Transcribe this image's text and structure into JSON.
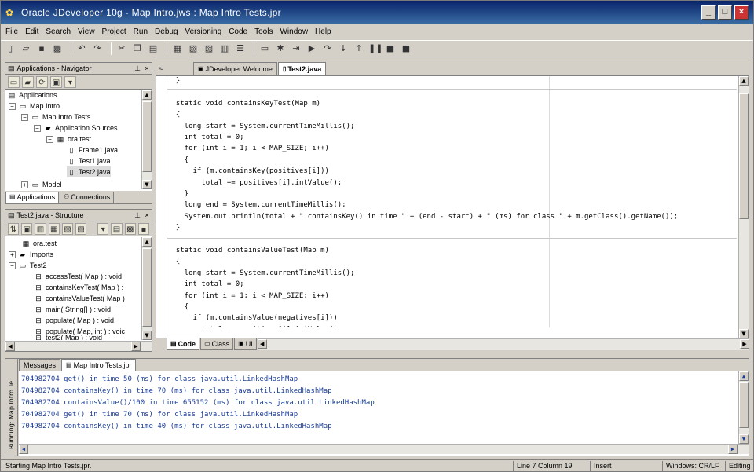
{
  "window": {
    "title": "Oracle JDeveloper 10g - Map Intro.jws : Map Intro Tests.jpr"
  },
  "menu": [
    "File",
    "Edit",
    "Search",
    "View",
    "Project",
    "Run",
    "Debug",
    "Versioning",
    "Code",
    "Tools",
    "Window",
    "Help"
  ],
  "navigator": {
    "title": "Applications - Navigator",
    "tree": [
      {
        "label": "Applications",
        "level": 0
      },
      {
        "label": "Map Intro",
        "level": 1
      },
      {
        "label": "Map Intro Tests",
        "level": 2
      },
      {
        "label": "Application Sources",
        "level": 3
      },
      {
        "label": "ora.test",
        "level": 4
      },
      {
        "label": "Frame1.java",
        "level": 5
      },
      {
        "label": "Test1.java",
        "level": 5
      },
      {
        "label": "Test2.java",
        "level": 5
      },
      {
        "label": "Model",
        "level": 2
      }
    ],
    "tabs": [
      "Applications",
      "Connections"
    ]
  },
  "structure": {
    "title": "Test2.java - Structure",
    "tree": [
      {
        "label": "ora.test",
        "level": 0
      },
      {
        "label": "Imports",
        "level": 0
      },
      {
        "label": "Test2",
        "level": 0
      },
      {
        "label": "accessTest( Map ) : void",
        "level": 1
      },
      {
        "label": "containsKeyTest( Map ) :",
        "level": 1
      },
      {
        "label": "containsValueTest( Map )",
        "level": 1
      },
      {
        "label": "main( String[] ) : void",
        "level": 1
      },
      {
        "label": "populate( Map ) : void",
        "level": 1
      },
      {
        "label": "populate( Map, int ) : voic",
        "level": 1
      },
      {
        "label": "test2( Map ) : void",
        "level": 1
      }
    ]
  },
  "editor": {
    "tabs": [
      "JDeveloper Welcome",
      "Test2.java"
    ],
    "active_tab": "Test2.java",
    "bottom_tabs": [
      "Code",
      "Class",
      "UI"
    ],
    "code_lines": [
      "  }",
      "",
      "  static void containsKeyTest(Map m)",
      "  {",
      "    long start = System.currentTimeMillis();",
      "    int total = 0;",
      "    for (int i = 1; i < MAP_SIZE; i++)",
      "    {",
      "      if (m.containsKey(positives[i]))",
      "        total += positives[i].intValue();",
      "    }",
      "    long end = System.currentTimeMillis();",
      "    System.out.println(total + \" containsKey() in time \" + (end - start) + \" (ms) for class \" + m.getClass().getName());",
      "  }",
      "",
      "  static void containsValueTest(Map m)",
      "  {",
      "    long start = System.currentTimeMillis();",
      "    int total = 0;",
      "    for (int i = 1; i < MAP_SIZE; i++)",
      "    {",
      "      if (m.containsValue(negatives[i]))",
      "        total += positives[i].intValue();"
    ]
  },
  "log": {
    "side_label": "Running: Map Intro Te",
    "tabs": [
      "Messages",
      "Map Intro Tests.jpr"
    ],
    "active_tab": "Map Intro Tests.jpr",
    "lines": [
      "704982704 get() in time 50 (ms) for class java.util.LinkedHashMap",
      "704982704 containsKey() in time 70 (ms) for class java.util.LinkedHashMap",
      "704982704 containsValue()/100 in time 655152 (ms) for class java.util.LinkedHashMap",
      "704982704 get() in time 70 (ms) for class java.util.LinkedHashMap",
      "704982704 containsKey() in time 40 (ms) for class java.util.LinkedHashMap"
    ]
  },
  "status": {
    "message": "Starting Map Intro Tests.jpr.",
    "position": "Line 7 Column 19",
    "mode": "Insert",
    "line_ending": "Windows: CR/LF",
    "state": "Editing"
  },
  "colors": {
    "titlebar": "#0a246a",
    "log_text": "#1a3d99",
    "chrome": "#d4d0c8"
  }
}
